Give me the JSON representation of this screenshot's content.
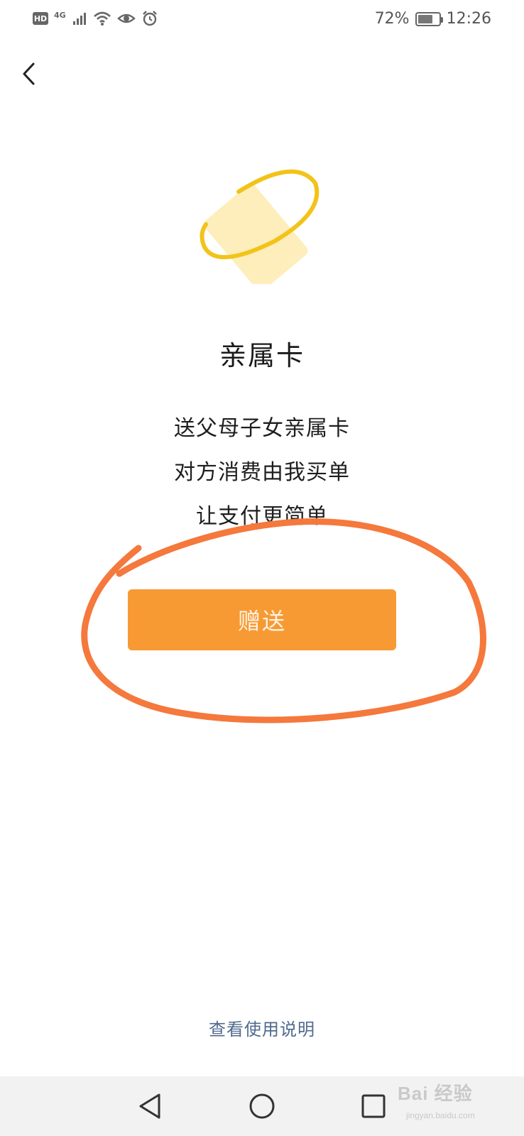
{
  "status_bar": {
    "hd": "HD",
    "network": "4G",
    "battery_percent": "72%",
    "battery_level": 0.72,
    "time": "12:26",
    "icons": [
      "signal-icon",
      "wifi-icon",
      "eye-icon",
      "alarm-icon",
      "battery-icon"
    ]
  },
  "header": {
    "back_icon": "chevron-left-icon"
  },
  "main": {
    "title": "亲属卡",
    "description": [
      "送父母子女亲属卡",
      "对方消费由我买单",
      "让支付更简单"
    ],
    "gift_button_label": "赠送",
    "help_link": "查看使用说明"
  },
  "nav_bar": {
    "icons": [
      "nav-back-icon",
      "nav-home-icon",
      "nav-recent-icon"
    ]
  },
  "watermark": {
    "text": "Bai 经验",
    "sub": "jingyan.baidu.com"
  },
  "colors": {
    "accent": "#f79a34",
    "card_fill": "#fdeebb",
    "ring": "#f2c318",
    "annotation": "#f5783c",
    "link": "#4f6a8f"
  }
}
